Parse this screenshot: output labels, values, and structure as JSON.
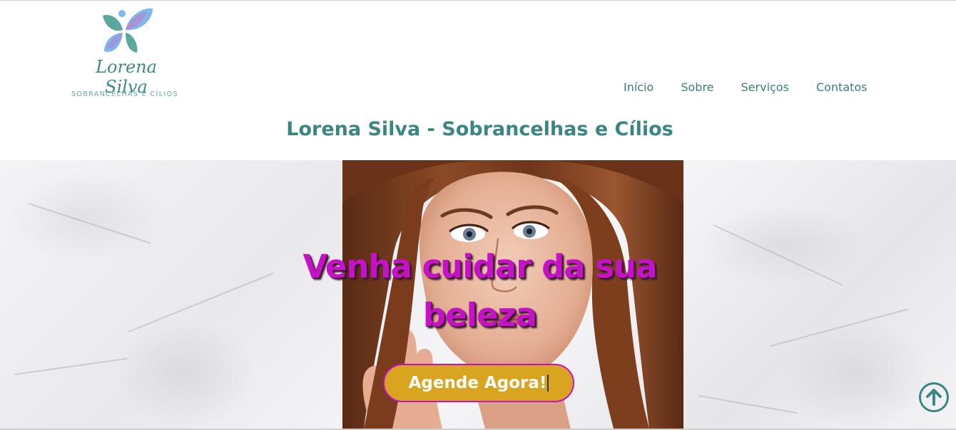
{
  "brand": {
    "logo_script": "Lorena Silva",
    "logo_tagline": "SOBRANCELHAS E CÍLIOS",
    "logo_icon": "butterfly-icon"
  },
  "nav": {
    "items": [
      {
        "label": "Início"
      },
      {
        "label": "Sobre"
      },
      {
        "label": "Serviços"
      },
      {
        "label": "Contatos"
      }
    ]
  },
  "site_title": "Lorena Silva - Sobrancelhas e Cílios",
  "hero": {
    "heading": "Venha cuidar da sua beleza",
    "cta_label": "Agende Agora!"
  },
  "back_to_top": {
    "icon": "arrow-up-circle-icon"
  },
  "colors": {
    "accent_teal": "#3b8683",
    "heading_magenta": "#c512c9",
    "cta_gold": "#d9a520"
  }
}
